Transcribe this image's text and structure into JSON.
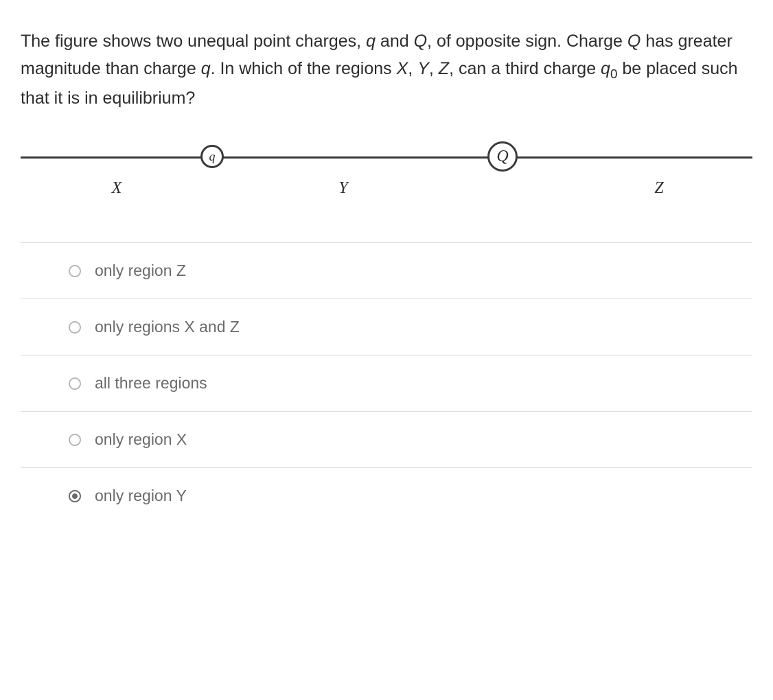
{
  "question": {
    "line1_prefix": "The figure shows two unequal point charges, ",
    "q_lower": "q",
    "line1_and": " and ",
    "Q_upper": "Q",
    "line1_suffix": ", of opposite sign.",
    "line2_prefix": "Charge ",
    "line2_mid1": " has greater magnitude than charge ",
    "line2_suffix": ". In which of the",
    "line3_prefix": "regions ",
    "X": "X",
    "Y": "Y",
    "Z": "Z",
    "comma1": ", ",
    "comma2": ", ",
    "line3_mid": ", can a third charge ",
    "q0_base": "q",
    "q0_sub": "0",
    "line3_suffix": " be placed such that it is in",
    "line4": "equilibrium?"
  },
  "figure": {
    "charge_small": "q",
    "charge_large": "Q",
    "region_x": "X",
    "region_y": "Y",
    "region_z": "Z"
  },
  "options": [
    {
      "label": "only region Z",
      "selected": false
    },
    {
      "label": "only regions X and Z",
      "selected": false
    },
    {
      "label": "all three regions",
      "selected": false
    },
    {
      "label": "only region X",
      "selected": false
    },
    {
      "label": "only region Y",
      "selected": true
    }
  ]
}
